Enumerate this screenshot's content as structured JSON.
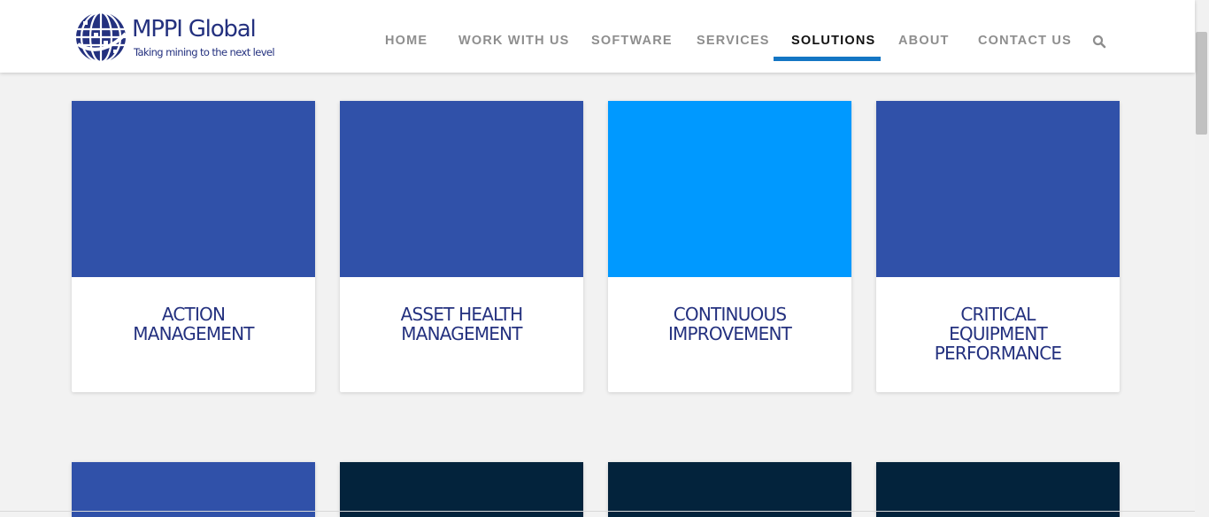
{
  "brand": {
    "name": "MPPI Global",
    "tagline": "Taking mining to the next level",
    "color": "#24317f"
  },
  "nav": {
    "items": [
      {
        "label": "HOME",
        "active": false
      },
      {
        "label": "WORK WITH US",
        "active": false
      },
      {
        "label": "SOFTWARE",
        "active": false
      },
      {
        "label": "SERVICES",
        "active": false
      },
      {
        "label": "SOLUTIONS",
        "active": true
      },
      {
        "label": "ABOUT",
        "active": false
      },
      {
        "label": "CONTACT US",
        "active": false
      }
    ],
    "search_icon": "search-icon",
    "accent": "#1476c4"
  },
  "cards": [
    {
      "title_lines": [
        "ACTION",
        "MANAGEMENT"
      ],
      "image_color": "#3051a9"
    },
    {
      "title_lines": [
        "ASSET HEALTH",
        "MANAGEMENT"
      ],
      "image_color": "#3051a9"
    },
    {
      "title_lines": [
        "CONTINUOUS",
        "IMPROVEMENT"
      ],
      "image_color": "#0099ff"
    },
    {
      "title_lines": [
        "CRITICAL",
        "EQUIPMENT",
        "PERFORMANCE"
      ],
      "image_color": "#3051a9"
    }
  ],
  "cards_row2": [
    {
      "image_color": "#3051a9"
    },
    {
      "image_color": "#03233c"
    },
    {
      "image_color": "#03233c"
    },
    {
      "image_color": "#03233c"
    }
  ]
}
